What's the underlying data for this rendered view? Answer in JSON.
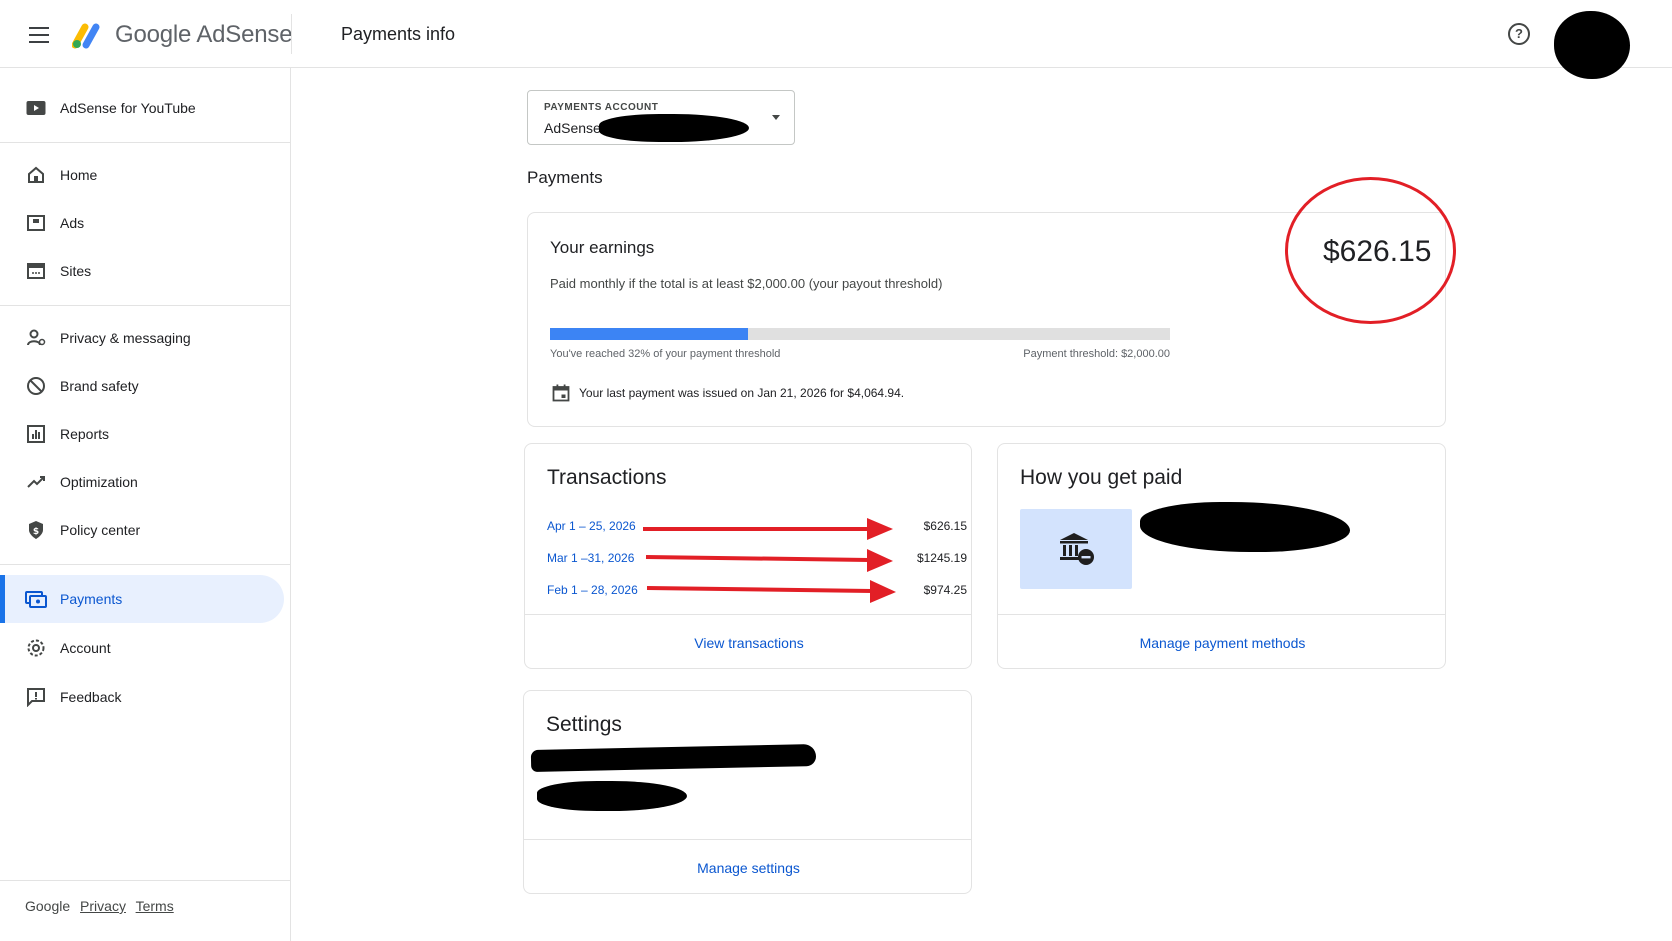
{
  "header": {
    "brand": "Google AdSense",
    "page_title": "Payments info",
    "help_glyph": "?"
  },
  "sidebar": {
    "items": [
      {
        "label": "AdSense for YouTube",
        "icon": "youtube-icon"
      },
      {
        "label": "Home",
        "icon": "home-icon"
      },
      {
        "label": "Ads",
        "icon": "ads-icon"
      },
      {
        "label": "Sites",
        "icon": "sites-icon"
      },
      {
        "label": "Privacy & messaging",
        "icon": "privacy-icon"
      },
      {
        "label": "Brand safety",
        "icon": "brand-safety-icon"
      },
      {
        "label": "Reports",
        "icon": "reports-icon"
      },
      {
        "label": "Optimization",
        "icon": "optimization-icon"
      },
      {
        "label": "Policy center",
        "icon": "policy-icon"
      },
      {
        "label": "Payments",
        "icon": "payments-icon",
        "active": true
      },
      {
        "label": "Account",
        "icon": "gear-icon"
      },
      {
        "label": "Feedback",
        "icon": "feedback-icon"
      }
    ],
    "footer": {
      "google": "Google",
      "privacy": "Privacy",
      "terms": "Terms"
    }
  },
  "account_select": {
    "caption": "PAYMENTS ACCOUNT",
    "value": "AdSense"
  },
  "payments_heading": "Payments",
  "earnings": {
    "title": "Your earnings",
    "description": "Paid monthly if the total is at least $2,000.00 (your payout threshold)",
    "amount": "$626.15",
    "progress_percent": 32,
    "progress_text": "You've reached 32% of your payment threshold",
    "threshold_text": "Payment threshold: $2,000.00",
    "last_payment": "Your last payment was issued on Jan 21, 2026 for $4,064.94."
  },
  "transactions": {
    "title": "Transactions",
    "rows": [
      {
        "date": "Apr 1 – 25, 2026",
        "amount": "$626.15"
      },
      {
        "date": "Mar 1 –31, 2026",
        "amount": "$1245.19"
      },
      {
        "date": "Feb 1 – 28, 2026",
        "amount": "$974.25"
      }
    ],
    "link": "View transactions"
  },
  "how_paid": {
    "title": "How you get paid",
    "link": "Manage payment methods"
  },
  "settings": {
    "title": "Settings",
    "link": "Manage settings"
  },
  "colors": {
    "accent": "#0b57d0",
    "active_bg": "#e8f0fe",
    "progress_fill": "#3c84f4",
    "annotation_red": "#e21f26"
  }
}
